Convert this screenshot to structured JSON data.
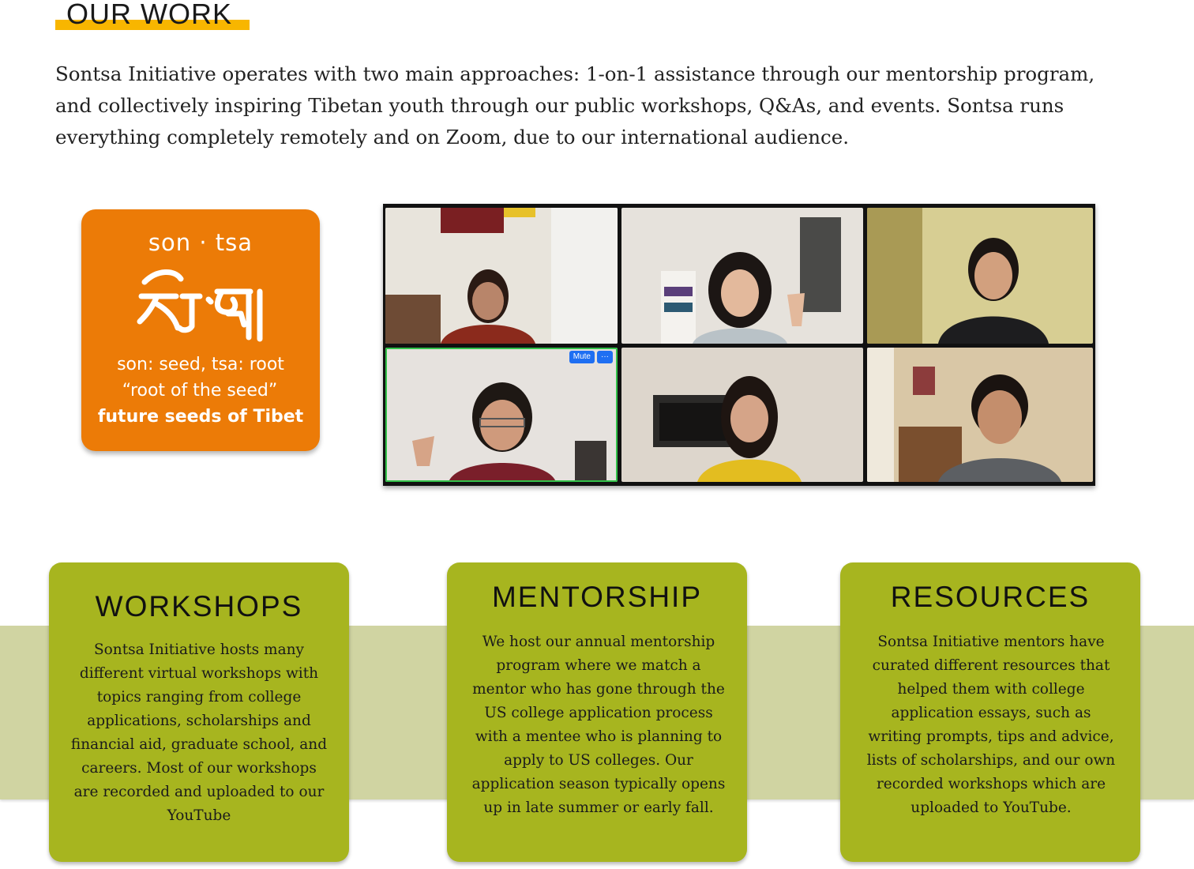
{
  "section": {
    "heading": "OUR WORK",
    "intro": "Sontsa Initiative operates with two main approaches: 1-on-1 assistance through our mentorship program, and collectively inspiring Tibetan youth through our public workshops, Q&As, and events. Sontsa runs everything completely remotely and on Zoom, due to our international audience."
  },
  "meaning_card": {
    "romanized": "son · tsa",
    "tibetan": "སོན་རྩ།",
    "line1": "son: seed, tsa: root",
    "line2": "“root of the seed”",
    "line3": "future seeds of Tibet"
  },
  "zoom": {
    "mute_label": "Mute",
    "more_label": "···"
  },
  "cards": [
    {
      "title": "WORKSHOPS",
      "body": "Sontsa Initiative hosts many different virtual workshops with topics ranging from college applications, scholarships and financial aid, graduate school, and careers. Most of our workshops are recorded and uploaded to our YouTube"
    },
    {
      "title": "MENTORSHIP",
      "body": "We host our annual mentorship program where we match a mentor who has gone through the US college application process with a mentee who is planning to apply to US colleges. Our application season typically opens up in late summer or early fall."
    },
    {
      "title": "RESOURCES",
      "body": "Sontsa Initiative mentors have curated different resources that helped them with college application essays, such as writing prompts, tips and advice, lists of scholarships, and our own recorded workshops which are uploaded to YouTube."
    }
  ],
  "colors": {
    "accent_yellow": "#f8b600",
    "card_orange": "#ec7b07",
    "card_green": "#a7b51f",
    "band_green": "#d0d4a2"
  }
}
